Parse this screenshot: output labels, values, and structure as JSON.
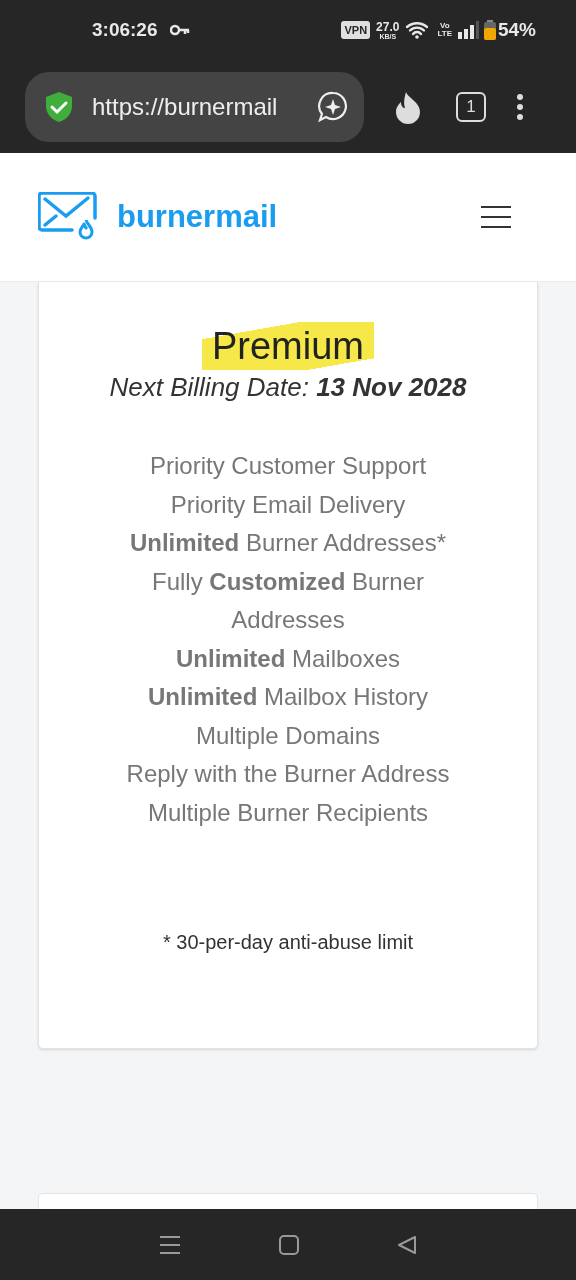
{
  "status_bar": {
    "time": "3:06:26",
    "vpn": "VPN",
    "speed": "27.0",
    "speed_unit": "KB/S",
    "volte_top": "Vo",
    "volte_bottom": "LTE",
    "battery": "54%"
  },
  "browser": {
    "url": "https://burnermail",
    "tab_count": "1"
  },
  "header": {
    "brand": "burnermail"
  },
  "plan": {
    "name": "Premium",
    "billing_label": "Next Billing Date:",
    "billing_date": "13 Nov 2028",
    "features": [
      "Priority Customer Support",
      "Priority Email Delivery",
      "**Unlimited** Burner Addresses*",
      "Fully **Customized** Burner Addresses",
      "**Unlimited** Mailboxes",
      "**Unlimited** Mailbox History",
      "Multiple Domains",
      "Reply with the Burner Address",
      "Multiple Burner Recipients"
    ],
    "footnote": "* 30-per-day anti-abuse limit"
  }
}
